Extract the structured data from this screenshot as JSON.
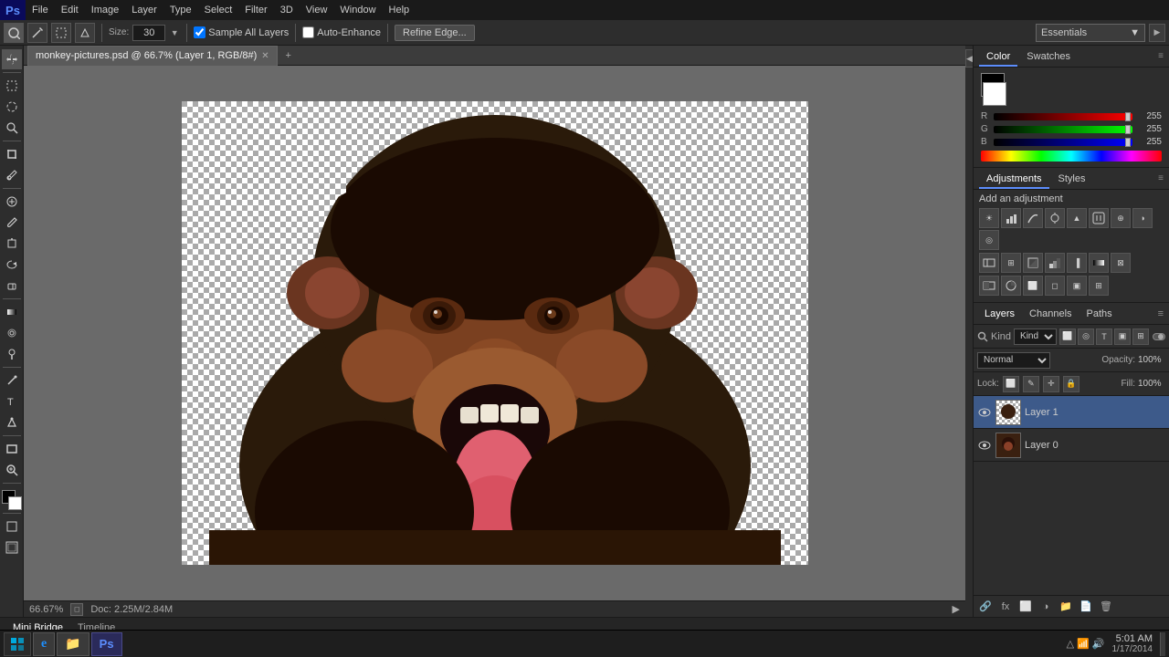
{
  "app": {
    "name": "Adobe Photoshop",
    "ps_logo": "Ps",
    "workspace": "Essentials"
  },
  "menubar": {
    "items": [
      "File",
      "Edit",
      "Image",
      "Layer",
      "Type",
      "Select",
      "Filter",
      "3D",
      "View",
      "Window",
      "Help"
    ]
  },
  "optionsbar": {
    "brush_size": "30",
    "sample_all_layers_label": "Sample All Layers",
    "auto_enhance_label": "Auto-Enhance",
    "refine_edge_label": "Refine Edge...",
    "essentials_label": "Essentials",
    "sample_all_layers_checked": true,
    "auto_enhance_checked": false
  },
  "document": {
    "title": "monkey-pictures.psd @ 66.7% (Layer 1, RGB/8#)"
  },
  "statusbar": {
    "zoom": "66.67%",
    "doc_size": "Doc: 2.25M/2.84M"
  },
  "color_panel": {
    "tab_color": "Color",
    "tab_swatches": "Swatches",
    "r_label": "R",
    "g_label": "G",
    "b_label": "B",
    "r_value": "255",
    "g_value": "255",
    "b_value": "255"
  },
  "adjustments_panel": {
    "tab_adjustments": "Adjustments",
    "tab_styles": "Styles",
    "add_adjustment_label": "Add an adjustment"
  },
  "layers_panel": {
    "tab_layers": "Layers",
    "tab_channels": "Channels",
    "tab_paths": "Paths",
    "filter_label": "Kind",
    "blend_mode": "Normal",
    "opacity_label": "Opacity:",
    "opacity_value": "100%",
    "lock_label": "Lock:",
    "fill_label": "Fill:",
    "fill_value": "100%",
    "layers": [
      {
        "name": "Layer 1",
        "visible": true,
        "active": true,
        "has_mask": true
      },
      {
        "name": "Layer 0",
        "visible": true,
        "active": false,
        "has_mask": false
      }
    ]
  },
  "bottom_tabs": {
    "mini_bridge": "Mini Bridge",
    "timeline": "Timeline"
  },
  "taskbar": {
    "ie_label": "Internet Explorer",
    "explorer_label": "File Explorer",
    "ps_label": "Adobe Photoshop",
    "clock": "5:01 AM",
    "date": "1/17/2014"
  }
}
